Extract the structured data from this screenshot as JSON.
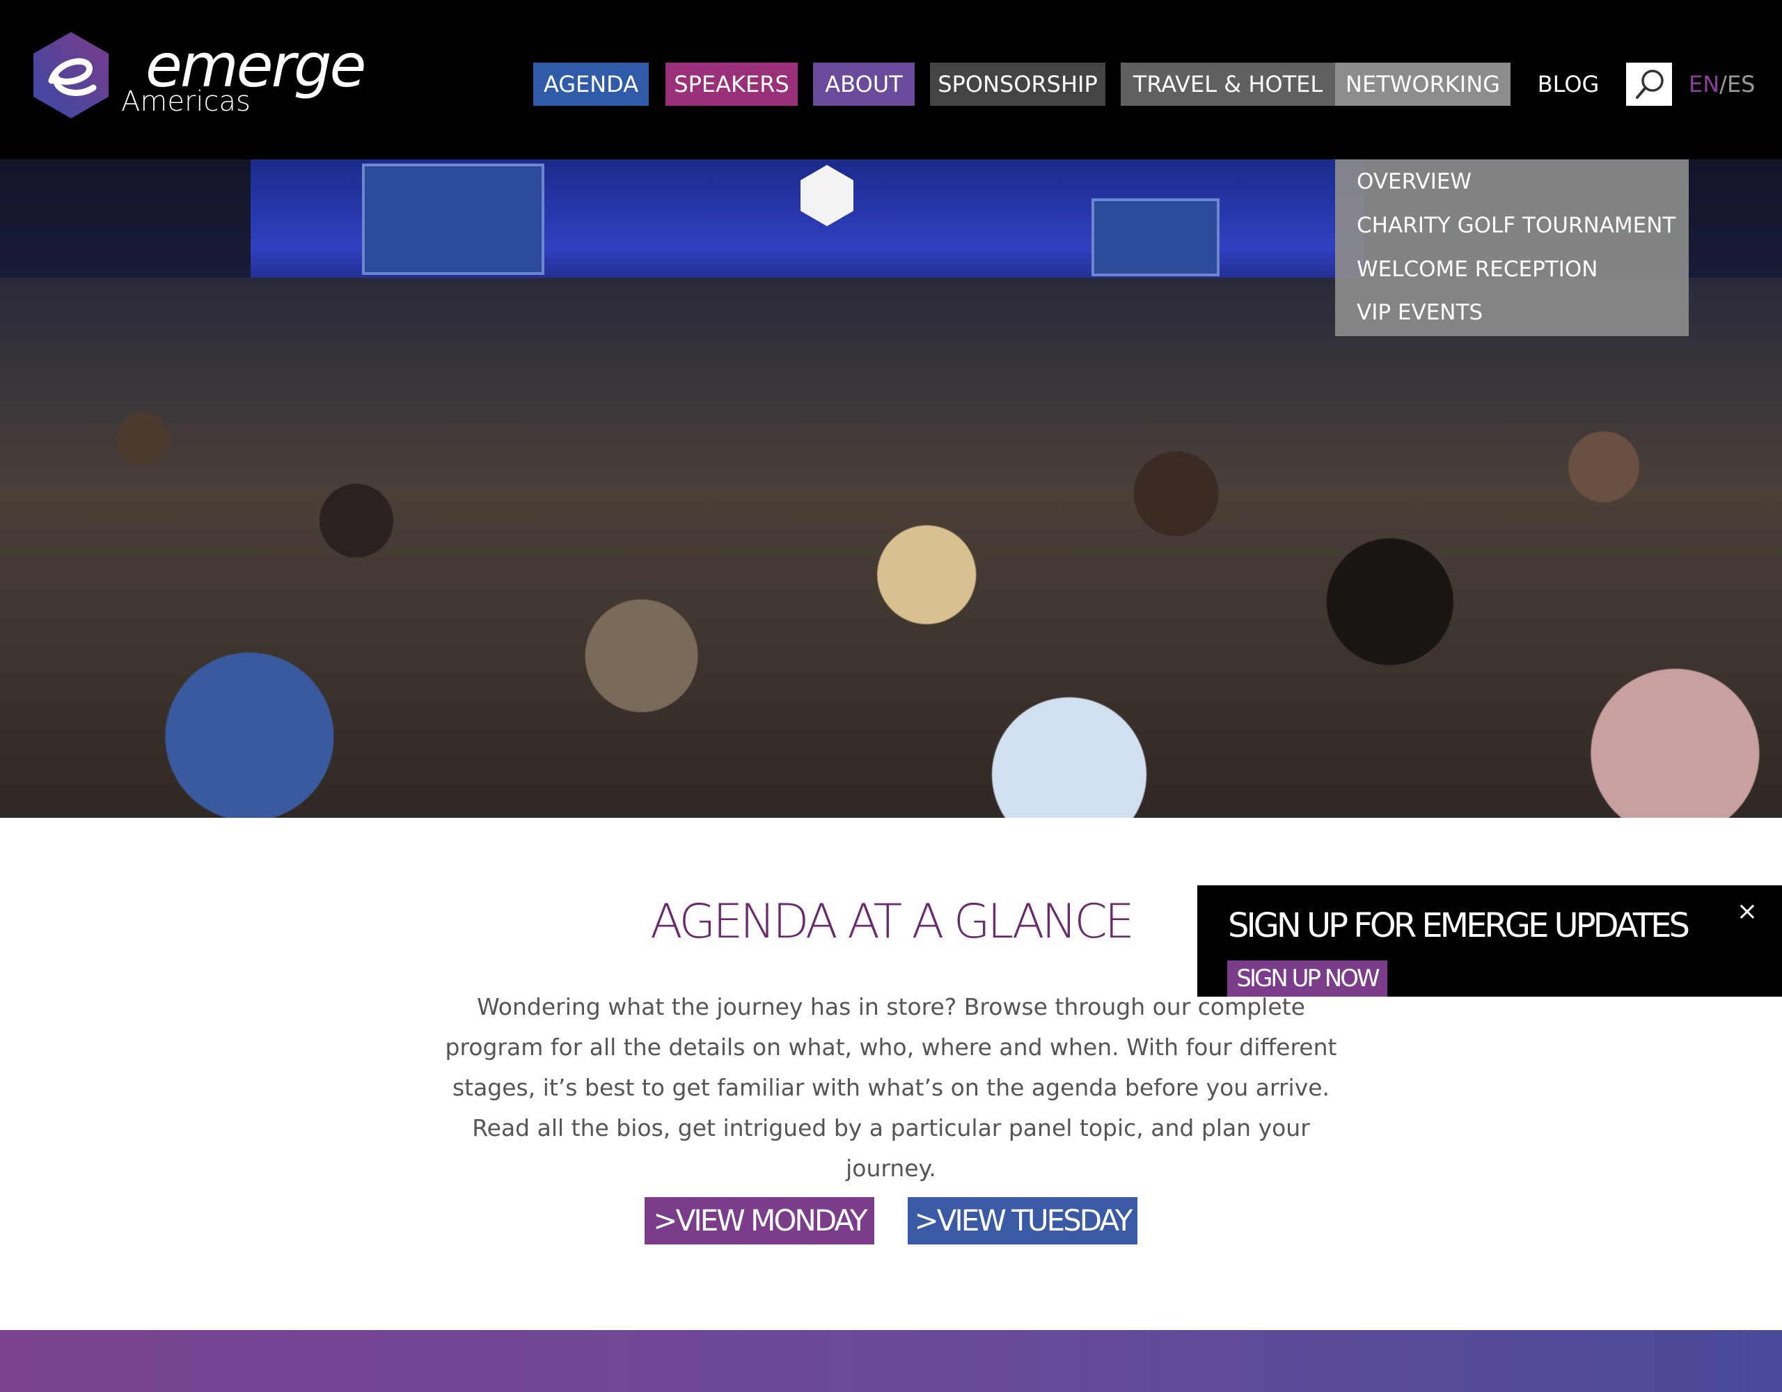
{
  "brand": {
    "name": "emerge",
    "sub": "Americas",
    "colors": {
      "hex_left": "#3a4aa6",
      "hex_right": "#7b3c8a"
    }
  },
  "nav": {
    "items": [
      {
        "label": "AGENDA",
        "bg": "#2f5ba8"
      },
      {
        "label": "SPEAKERS",
        "bg": "#9a2f7a"
      },
      {
        "label": "ABOUT",
        "bg": "#6a4a9a"
      },
      {
        "label": "SPONSORSHIP",
        "bg": "#444444"
      },
      {
        "label": "TRAVEL & HOTEL",
        "bg": "#606060"
      },
      {
        "label": "NETWORKING",
        "bg": "#8c8c8c"
      },
      {
        "label": "BLOG",
        "bg": ""
      }
    ],
    "search_icon": "search-icon",
    "lang": {
      "en": "EN",
      "sep": "/",
      "es": "ES"
    }
  },
  "dropdown": {
    "items": [
      "OVERVIEW",
      "CHARITY GOLF TOURNAMENT",
      "WELCOME RECEPTION",
      "VIP EVENTS"
    ]
  },
  "agenda": {
    "title": "AGENDA  AT A GLANCE",
    "text": "Wondering what the journey has in store? Browse through our complete program for all the details on what, who, where and when. With four different stages, it’s best to get familiar with what’s on the agenda before you arrive. Read all the bios, get intrigued by a particular panel topic, and plan your journey.",
    "buttons": [
      {
        "label": ">VIEW MONDAY",
        "bg": "#7b3c8a"
      },
      {
        "label": ">VIEW TUESDAY",
        "bg": "#3a5aa6"
      }
    ]
  },
  "signup": {
    "title": "SIGN UP FOR EMERGE UPDATES",
    "button": "SIGN UP NOW",
    "close": "×"
  }
}
